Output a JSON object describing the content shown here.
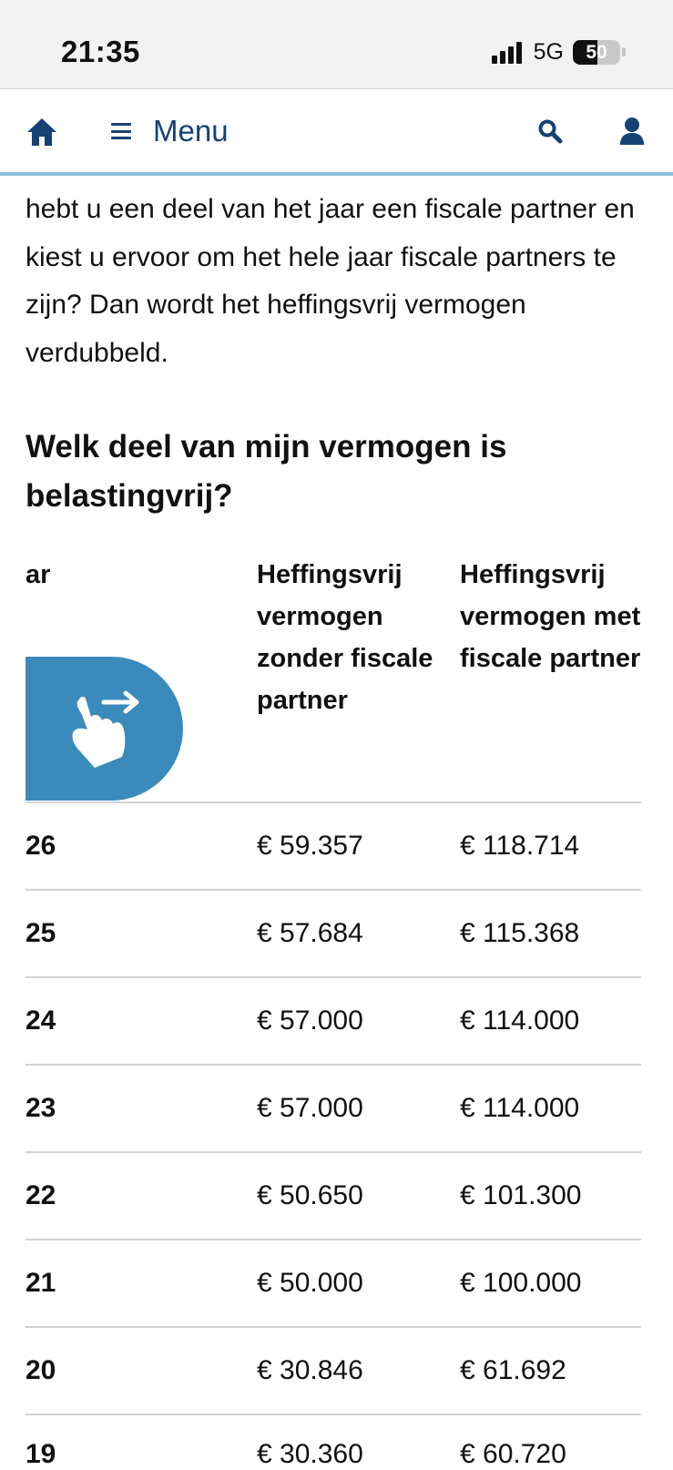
{
  "status": {
    "time": "21:35",
    "network": "5G",
    "battery": "50"
  },
  "nav": {
    "menu_label": "Menu",
    "icons": [
      "home-icon",
      "menu-icon",
      "search-icon",
      "user-icon"
    ]
  },
  "content": {
    "intro": "hebt u een deel van het jaar een fiscale partner en kiest u ervoor om het hele jaar fiscale partners te zijn? Dan wordt het heffingsvrij vermogen verdubbeld.",
    "heading": "Welk deel van mijn vermogen is belastingvrij?"
  },
  "table": {
    "headers": {
      "year": "ar",
      "without_partner": "Heffingsvrij vermogen zonder fiscale partner",
      "with_partner": "Heffingsvrij vermogen met fiscale partner"
    },
    "rows": [
      {
        "year": "26",
        "without": "€ 59.357",
        "with": "€ 118.714"
      },
      {
        "year": "25",
        "without": "€ 57.684",
        "with": "€ 115.368"
      },
      {
        "year": "24",
        "without": "€ 57.000",
        "with": "€ 114.000"
      },
      {
        "year": "23",
        "without": "€ 57.000",
        "with": "€ 114.000"
      },
      {
        "year": "22",
        "without": "€ 50.650",
        "with": "€ 101.300"
      },
      {
        "year": "21",
        "without": "€ 50.000",
        "with": "€ 100.000"
      },
      {
        "year": "20",
        "without": "€ 30.846",
        "with": "€ 61.692"
      },
      {
        "year": "19",
        "without": "€ 30.360",
        "with": "€ 60.720"
      }
    ]
  },
  "colors": {
    "brand": "#154273",
    "accent": "#3a8bbb",
    "nav_border": "#8fc1dc"
  }
}
